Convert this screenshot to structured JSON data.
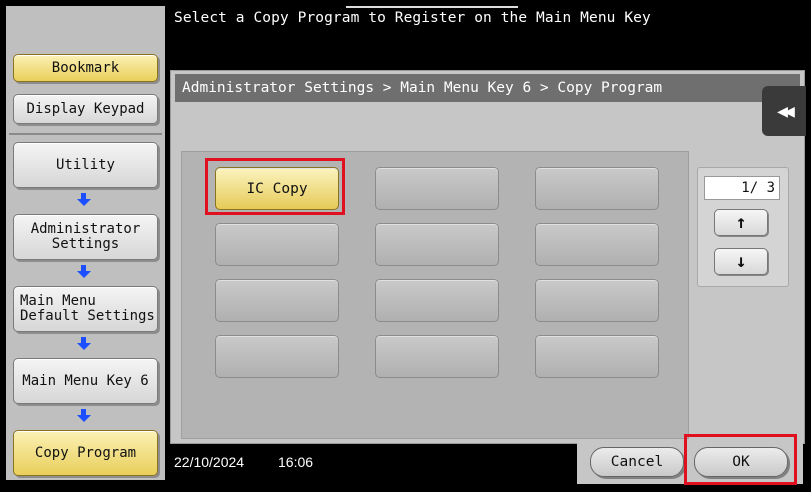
{
  "header": {
    "message": "Select a Copy Program to Register on the Main Menu Key"
  },
  "sidebar": {
    "bookmark": "Bookmark",
    "display_keypad": "Display Keypad",
    "path": [
      {
        "label": "Utility"
      },
      {
        "label": "Administrator Settings"
      },
      {
        "label": "Main Menu Default Settings"
      },
      {
        "label": "Main Menu Key 6"
      },
      {
        "label": "Copy Program"
      }
    ]
  },
  "breadcrumb": "Administrator Settings > Main Menu Key 6 > Copy Program",
  "programs": {
    "selected_label": "IC Copy"
  },
  "pager": {
    "page": "1/ 3",
    "up_icon": "arrow-up-icon",
    "down_icon": "arrow-down-icon"
  },
  "status": {
    "date": "22/10/2024",
    "time": "16:06"
  },
  "actions": {
    "cancel": "Cancel",
    "ok": "OK"
  },
  "colors": {
    "selected": "#e9cf5b",
    "highlight": "#e01020",
    "flow_arrow": "#1c50ff"
  }
}
